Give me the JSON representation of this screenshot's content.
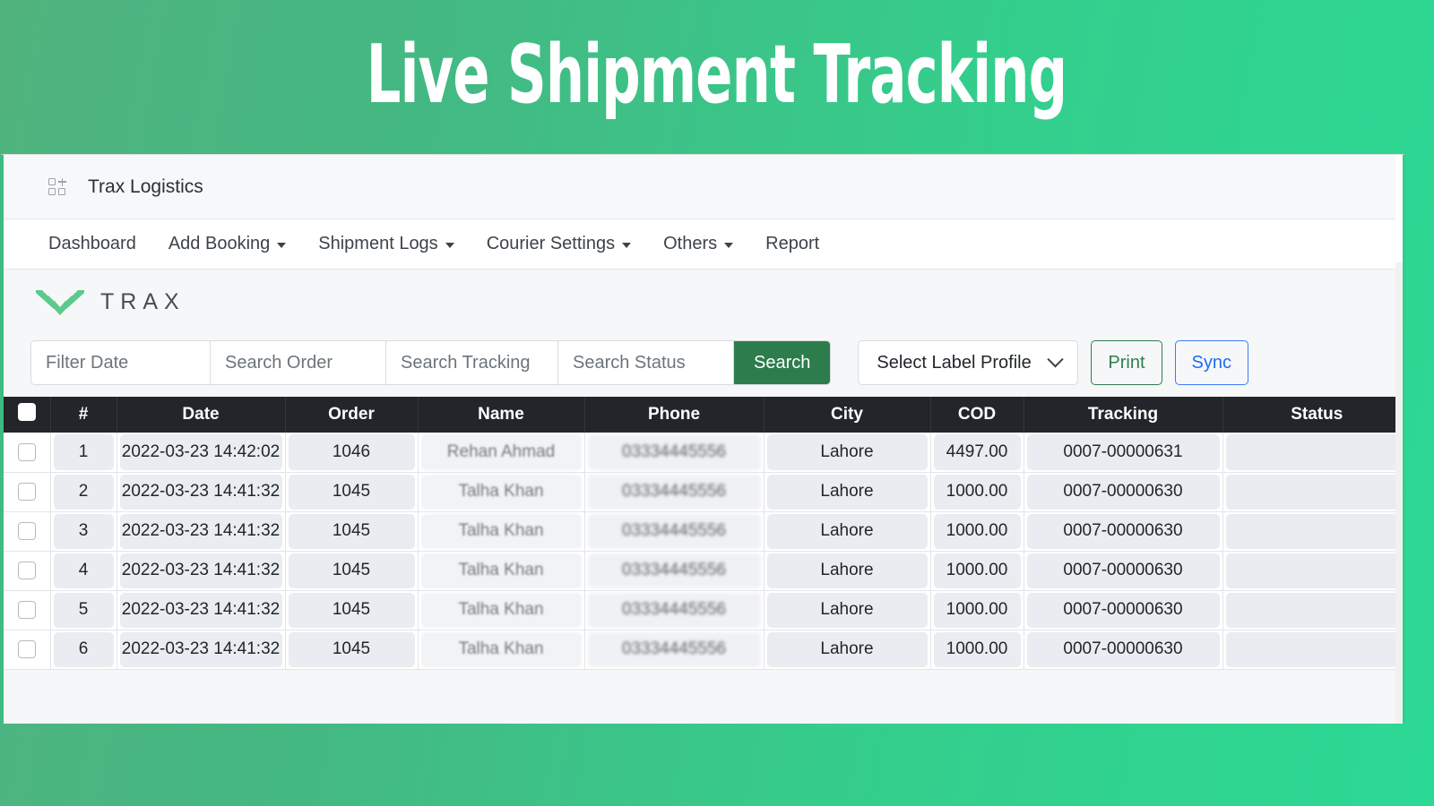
{
  "hero": {
    "title": "Live Shipment Tracking",
    "bg_from": "#50b37e",
    "bg_to": "#2bd994"
  },
  "appbar": {
    "icon": "grid-plus-icon",
    "title": "Trax Logistics"
  },
  "nav": {
    "items": [
      {
        "label": "Dashboard",
        "caret": false
      },
      {
        "label": "Add Booking",
        "caret": true
      },
      {
        "label": "Shipment Logs",
        "caret": true
      },
      {
        "label": "Courier Settings",
        "caret": true
      },
      {
        "label": "Others",
        "caret": true
      },
      {
        "label": "Report",
        "caret": false
      }
    ]
  },
  "brand": {
    "wordmark": "TRAX",
    "mark_color": "#5ec98c",
    "word_color": "#474e55"
  },
  "toolbar": {
    "filter_date": {
      "value": "",
      "placeholder": "Filter Date"
    },
    "search_order": {
      "value": "",
      "placeholder": "Search Order"
    },
    "search_tracking": {
      "value": "",
      "placeholder": "Search Tracking"
    },
    "search_status": {
      "value": "",
      "placeholder": "Search Status"
    },
    "search_button": "Search",
    "label_profile": {
      "selected": "Select Label Profile"
    },
    "print_button": "Print",
    "sync_button": "Sync",
    "search_button_color": "#2d7d4c",
    "print_color": "#2f7d4e",
    "sync_color": "#1f6bf5"
  },
  "table": {
    "header_bg": "#22262b",
    "columns": [
      "",
      "#",
      "Date",
      "Order",
      "Name",
      "Phone",
      "City",
      "COD",
      "Tracking",
      "Status"
    ],
    "rows": [
      {
        "num": "1",
        "date": "2022-03-23 14:42:02",
        "order": "1046",
        "name": "Rehan Ahmad",
        "phone": "03334445556",
        "city": "Lahore",
        "cod": "4497.00",
        "tracking": "0007-00000631",
        "status": ""
      },
      {
        "num": "2",
        "date": "2022-03-23 14:41:32",
        "order": "1045",
        "name": "Talha Khan",
        "phone": "03334445556",
        "city": "Lahore",
        "cod": "1000.00",
        "tracking": "0007-00000630",
        "status": ""
      },
      {
        "num": "3",
        "date": "2022-03-23 14:41:32",
        "order": "1045",
        "name": "Talha Khan",
        "phone": "03334445556",
        "city": "Lahore",
        "cod": "1000.00",
        "tracking": "0007-00000630",
        "status": ""
      },
      {
        "num": "4",
        "date": "2022-03-23 14:41:32",
        "order": "1045",
        "name": "Talha Khan",
        "phone": "03334445556",
        "city": "Lahore",
        "cod": "1000.00",
        "tracking": "0007-00000630",
        "status": ""
      },
      {
        "num": "5",
        "date": "2022-03-23 14:41:32",
        "order": "1045",
        "name": "Talha Khan",
        "phone": "03334445556",
        "city": "Lahore",
        "cod": "1000.00",
        "tracking": "0007-00000630",
        "status": ""
      },
      {
        "num": "6",
        "date": "2022-03-23 14:41:32",
        "order": "1045",
        "name": "Talha Khan",
        "phone": "03334445556",
        "city": "Lahore",
        "cod": "1000.00",
        "tracking": "0007-00000630",
        "status": ""
      }
    ]
  }
}
